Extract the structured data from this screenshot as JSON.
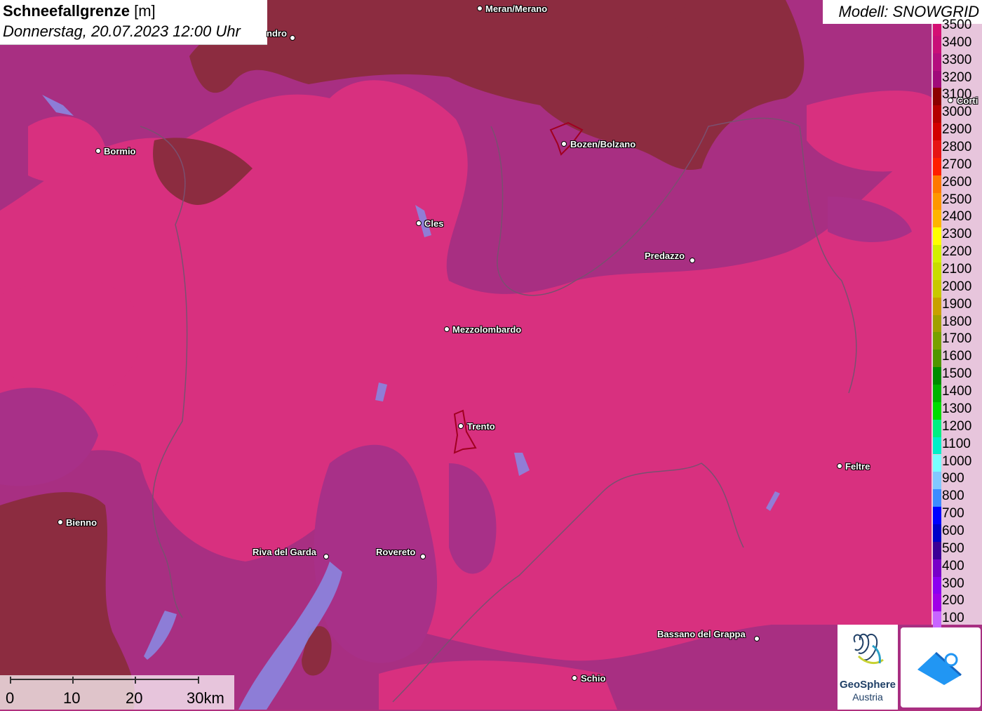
{
  "title": {
    "variable": "Schneefallgrenze",
    "unit": "[m]",
    "datetime": "Donnerstag, 20.07.2023 12:00 Uhr"
  },
  "model": {
    "label": "Modell: SNOWGRID"
  },
  "legend": {
    "items": [
      {
        "label": "3500",
        "color": "#d40f74"
      },
      {
        "label": "3400",
        "color": "#c80f78"
      },
      {
        "label": "3300",
        "color": "#b40e7e"
      },
      {
        "label": "3200",
        "color": "#a00a7a"
      },
      {
        "label": "3100",
        "color": "#8c0000"
      },
      {
        "label": "3000",
        "color": "#b40000"
      },
      {
        "label": "2900",
        "color": "#d20000"
      },
      {
        "label": "2800",
        "color": "#e61414"
      },
      {
        "label": "2700",
        "color": "#ff1e00"
      },
      {
        "label": "2600",
        "color": "#ff7800"
      },
      {
        "label": "2500",
        "color": "#ff9600"
      },
      {
        "label": "2400",
        "color": "#ffb400"
      },
      {
        "label": "2300",
        "color": "#ffff00"
      },
      {
        "label": "2200",
        "color": "#d2f000"
      },
      {
        "label": "2100",
        "color": "#c8dc00"
      },
      {
        "label": "2000",
        "color": "#c8c800"
      },
      {
        "label": "1900",
        "color": "#c8a000"
      },
      {
        "label": "1800",
        "color": "#a0a000"
      },
      {
        "label": "1700",
        "color": "#78a000"
      },
      {
        "label": "1600",
        "color": "#509600"
      },
      {
        "label": "1500",
        "color": "#008c00"
      },
      {
        "label": "1400",
        "color": "#00b400"
      },
      {
        "label": "1300",
        "color": "#00dc00"
      },
      {
        "label": "1200",
        "color": "#00f082"
      },
      {
        "label": "1100",
        "color": "#00f0c8"
      },
      {
        "label": "1000",
        "color": "#78ffff"
      },
      {
        "label": "900",
        "color": "#82c8ff"
      },
      {
        "label": "800",
        "color": "#3c8cff"
      },
      {
        "label": "700",
        "color": "#0000ff"
      },
      {
        "label": "600",
        "color": "#0000c8"
      },
      {
        "label": "500",
        "color": "#3c0096"
      },
      {
        "label": "400",
        "color": "#7800c8"
      },
      {
        "label": "300",
        "color": "#8c00f0"
      },
      {
        "label": "200",
        "color": "#a000e6"
      },
      {
        "label": "100",
        "color": "#c864ff"
      }
    ]
  },
  "cities": [
    {
      "name": "Meran/Merano"
    },
    {
      "name": "ndro"
    },
    {
      "name": "Bormio"
    },
    {
      "name": "Bozen/Bolzano"
    },
    {
      "name": "Cles"
    },
    {
      "name": "Predazzo"
    },
    {
      "name": "Mezzolombardo"
    },
    {
      "name": "Trento"
    },
    {
      "name": "Feltre"
    },
    {
      "name": "Bienno"
    },
    {
      "name": "Riva del Garda"
    },
    {
      "name": "Rovereto"
    },
    {
      "name": "Bassano del Grappa"
    },
    {
      "name": "Schio"
    },
    {
      "name": "Corti"
    }
  ],
  "scalebar": {
    "labels": [
      "0",
      "10",
      "20",
      "30km"
    ]
  },
  "logos": {
    "geosphere_line1": "GeoSphere",
    "geosphere_line2": "Austria"
  },
  "colors": {
    "map_base": "#b0307e",
    "high_zone": "#e0307f",
    "brown_zone": "#8a2a3e",
    "lake": "#8080e0"
  }
}
